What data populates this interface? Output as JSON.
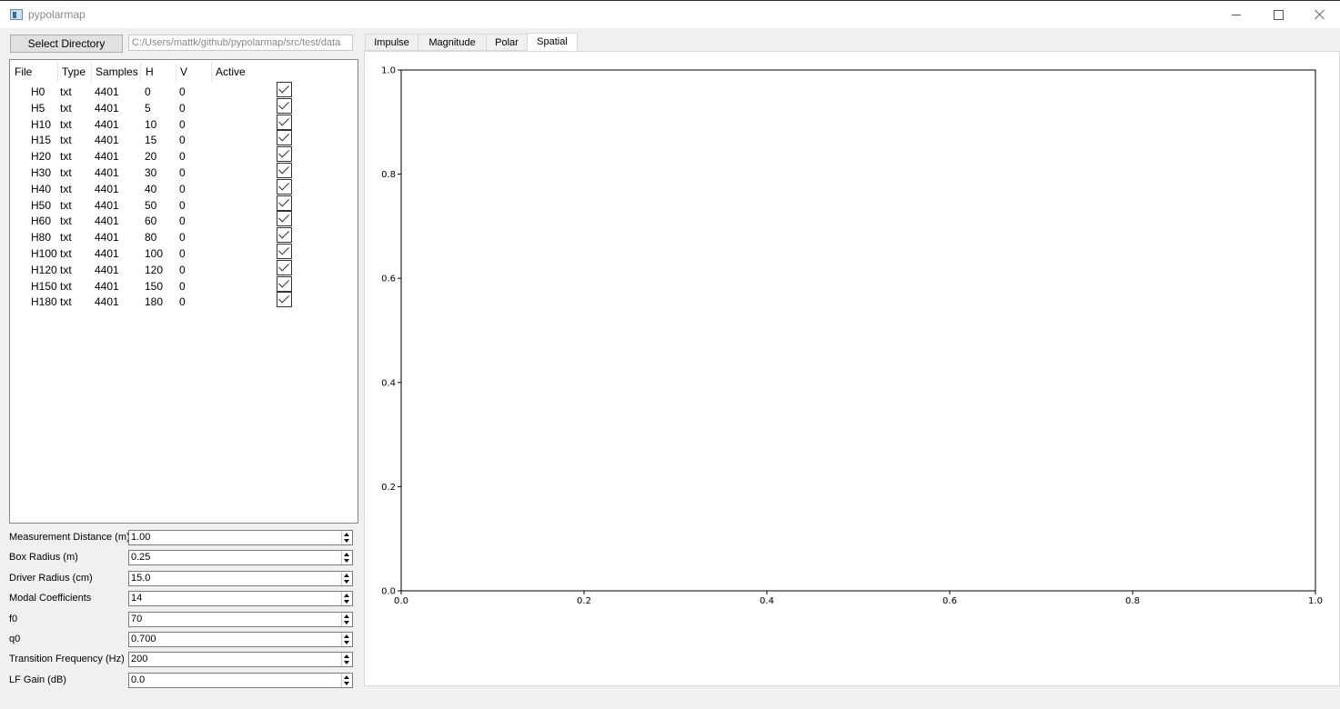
{
  "window": {
    "title": "pypolarmap"
  },
  "toolbar": {
    "select_directory_label": "Select Directory",
    "directory_path": "C:/Users/mattk/github/pypolarmap/src/test/data"
  },
  "file_table": {
    "headers": [
      "File",
      "Type",
      "Samples",
      "H",
      "V",
      "Active"
    ],
    "rows": [
      {
        "file": "H0",
        "type": "txt",
        "samples": "4401",
        "h": "0",
        "v": "0",
        "active": true
      },
      {
        "file": "H5",
        "type": "txt",
        "samples": "4401",
        "h": "5",
        "v": "0",
        "active": true
      },
      {
        "file": "H10",
        "type": "txt",
        "samples": "4401",
        "h": "10",
        "v": "0",
        "active": true
      },
      {
        "file": "H15",
        "type": "txt",
        "samples": "4401",
        "h": "15",
        "v": "0",
        "active": true
      },
      {
        "file": "H20",
        "type": "txt",
        "samples": "4401",
        "h": "20",
        "v": "0",
        "active": true
      },
      {
        "file": "H30",
        "type": "txt",
        "samples": "4401",
        "h": "30",
        "v": "0",
        "active": true
      },
      {
        "file": "H40",
        "type": "txt",
        "samples": "4401",
        "h": "40",
        "v": "0",
        "active": true
      },
      {
        "file": "H50",
        "type": "txt",
        "samples": "4401",
        "h": "50",
        "v": "0",
        "active": true
      },
      {
        "file": "H60",
        "type": "txt",
        "samples": "4401",
        "h": "60",
        "v": "0",
        "active": true
      },
      {
        "file": "H80",
        "type": "txt",
        "samples": "4401",
        "h": "80",
        "v": "0",
        "active": true
      },
      {
        "file": "H100",
        "type": "txt",
        "samples": "4401",
        "h": "100",
        "v": "0",
        "active": true
      },
      {
        "file": "H120",
        "type": "txt",
        "samples": "4401",
        "h": "120",
        "v": "0",
        "active": true
      },
      {
        "file": "H150",
        "type": "txt",
        "samples": "4401",
        "h": "150",
        "v": "0",
        "active": true
      },
      {
        "file": "H180",
        "type": "txt",
        "samples": "4401",
        "h": "180",
        "v": "0",
        "active": true
      }
    ]
  },
  "parameters": [
    {
      "name": "measurement-distance",
      "label": "Measurement Distance (m)",
      "value": "1.00"
    },
    {
      "name": "box-radius",
      "label": "Box Radius (m)",
      "value": "0.25"
    },
    {
      "name": "driver-radius",
      "label": "Driver Radius (cm)",
      "value": "15.0"
    },
    {
      "name": "modal-coefficients",
      "label": "Modal Coefficients",
      "value": "14"
    },
    {
      "name": "f0",
      "label": "f0",
      "value": "70"
    },
    {
      "name": "q0",
      "label": "q0",
      "value": "0.700"
    },
    {
      "name": "transition-frequency",
      "label": "Transition Frequency (Hz)",
      "value": "200"
    },
    {
      "name": "lf-gain",
      "label": "LF Gain (dB)",
      "value": "0.0"
    }
  ],
  "tabs": [
    {
      "label": "Impulse",
      "active": false
    },
    {
      "label": "Magnitude",
      "active": false
    },
    {
      "label": "Polar",
      "active": false
    },
    {
      "label": "Spatial",
      "active": true
    }
  ],
  "chart_data": {
    "type": "line",
    "series": [],
    "xlim": [
      0.0,
      1.0
    ],
    "ylim": [
      0.0,
      1.0
    ],
    "xticks": [
      "0.0",
      "0.2",
      "0.4",
      "0.6",
      "0.8",
      "1.0"
    ],
    "yticks": [
      "0.0",
      "0.2",
      "0.4",
      "0.6",
      "0.8",
      "1.0"
    ],
    "grid": false
  }
}
